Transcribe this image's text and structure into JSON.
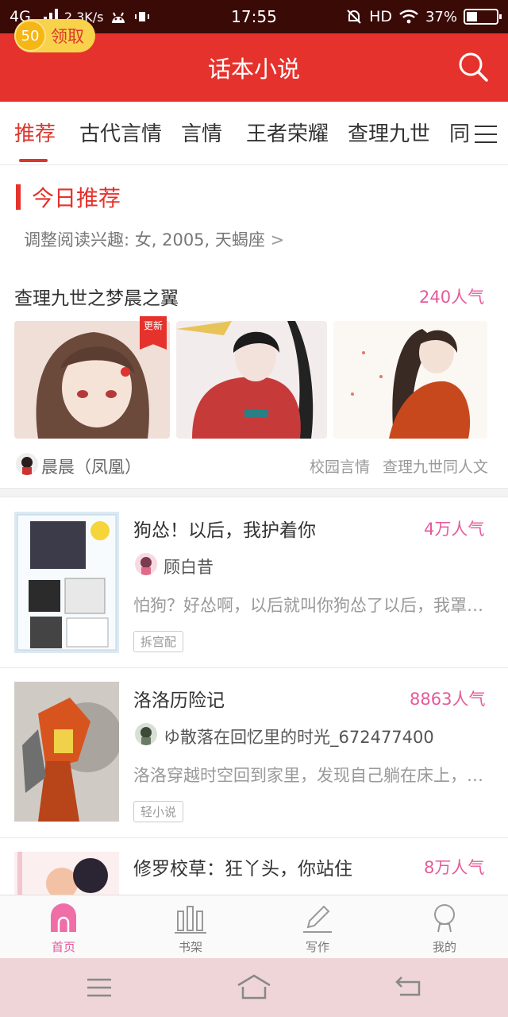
{
  "status_bar": {
    "network": "4G",
    "speed": "2.3K/s",
    "time": "17:55",
    "hd": "HD",
    "battery": "37%",
    "battery_level": 0.37
  },
  "header": {
    "coin_count": "50",
    "claim_label": "领取",
    "title": "话本小说"
  },
  "tabs": [
    "推荐",
    "古代言情",
    "言情",
    "王者荣耀",
    "查理九世",
    "同人"
  ],
  "tabs_truncated_last": "同,",
  "today": {
    "section_title": "今日推荐",
    "interest_text": "调整阅读兴趣: 女, 2005, 天蝎座",
    "featured": {
      "title": "查理九世之梦晨之翼",
      "popularity": "240人气",
      "badge": "更新",
      "author": "晨晨（凤凰）",
      "tags": [
        "校园言情",
        "查理九世同人文"
      ]
    }
  },
  "books": [
    {
      "title": "狗怂！以后，我护着你",
      "popularity": "4万人气",
      "author": "顾白昔",
      "description": "怕狗？好怂啊，以后就叫你狗怂了以后，我罩着你",
      "tag": "拆宫配"
    },
    {
      "title": "洛洛历险记",
      "popularity": "8863人气",
      "author": "ゆ散落在回忆里的时光_672477400",
      "description": "洛洛穿越时空回到家里，发现自己躺在床上，心里…",
      "tag": "轻小说"
    },
    {
      "title": "修罗校草：狂丫头，你站住",
      "popularity": "8万人气"
    }
  ],
  "bottom_nav": [
    {
      "label": "首页",
      "active": true
    },
    {
      "label": "书架",
      "active": false
    },
    {
      "label": "写作",
      "active": false
    },
    {
      "label": "我的",
      "active": false
    }
  ],
  "colors": {
    "brand_red": "#e6322c",
    "popularity_pink": "#e65a9a",
    "status_bar": "#3a0a07"
  }
}
